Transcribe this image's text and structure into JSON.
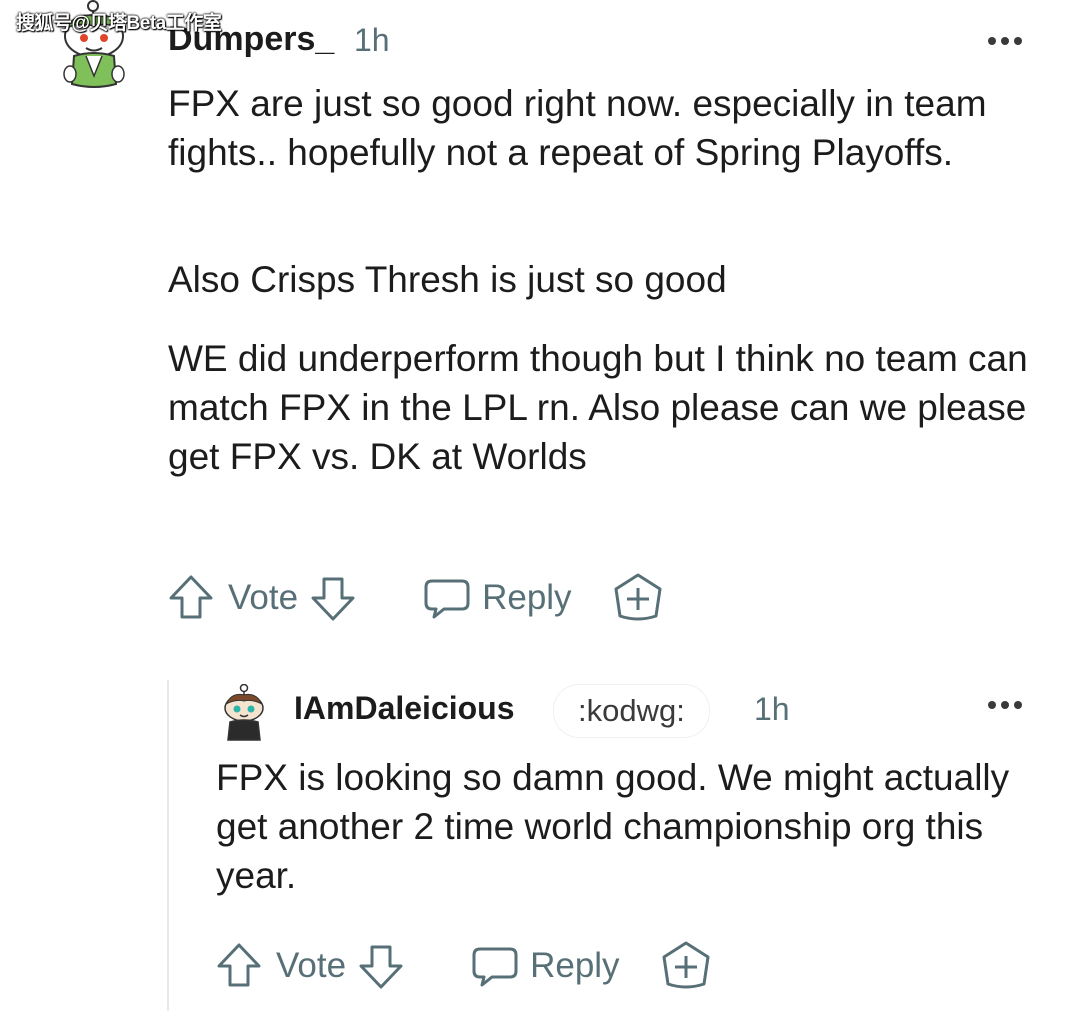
{
  "watermark": "搜狐号@贝塔Beta工作室",
  "comment": {
    "username": "Dumpers_",
    "time": "1h",
    "paragraphs": [
      "FPX are just so good right now. especially in team fights.. hopefully not a repeat of Spring Playoffs.",
      "Also Crisps Thresh is just so good",
      "WE did underperform though but I think no team can match FPX in the LPL rn. Also please can we please get FPX vs. DK at Worlds"
    ],
    "actions": {
      "vote": "Vote",
      "reply": "Reply"
    }
  },
  "reply": {
    "username": "IAmDaleicious",
    "flair": ":kodwg:",
    "time": "1h",
    "text": "FPX is looking so damn good. We might actually get another 2 time world championship org this year.",
    "actions": {
      "vote": "Vote",
      "reply": "Reply"
    }
  },
  "icons": {
    "upvote": "upvote-arrow-icon",
    "downvote": "downvote-arrow-icon",
    "reply": "speech-bubble-icon",
    "award": "plus-badge-icon",
    "more": "more-options-icon"
  },
  "colors": {
    "text": "#1c1c1c",
    "meta": "#576f76",
    "avatar_green": "#7fc05a"
  }
}
